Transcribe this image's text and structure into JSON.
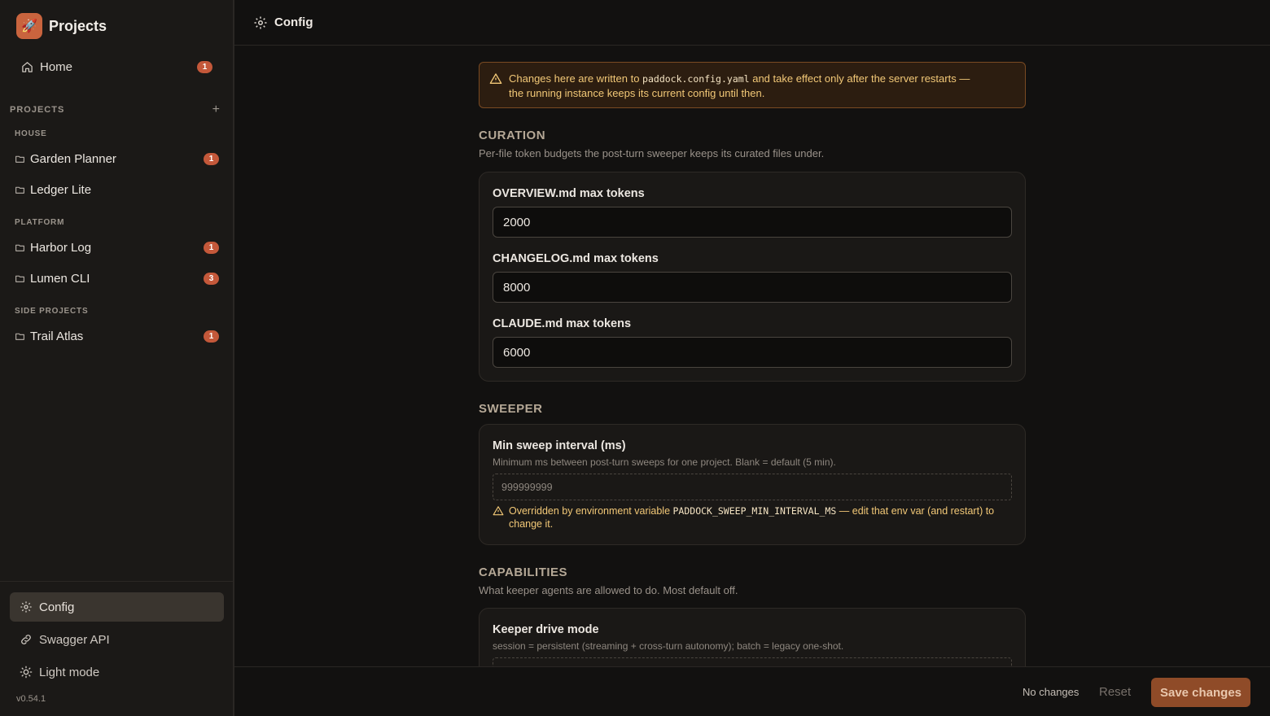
{
  "app": {
    "title": "Projects",
    "logo_glyph": "🚀",
    "version": "v0.54.1"
  },
  "sidebar": {
    "home": {
      "label": "Home",
      "badge": "1"
    },
    "projects_label": "PROJECTS",
    "add_glyph": "+",
    "groups": [
      {
        "label": "HOUSE",
        "items": [
          {
            "label": "Garden Planner",
            "badge": "1"
          },
          {
            "label": "Ledger Lite",
            "badge": ""
          }
        ]
      },
      {
        "label": "PLATFORM",
        "items": [
          {
            "label": "Harbor Log",
            "badge": "1"
          },
          {
            "label": "Lumen CLI",
            "badge": "3"
          }
        ]
      },
      {
        "label": "SIDE PROJECTS",
        "items": [
          {
            "label": "Trail Atlas",
            "badge": "1"
          }
        ]
      }
    ],
    "bottom": {
      "config": "Config",
      "swagger": "Swagger API",
      "theme": "Light mode"
    }
  },
  "topbar": {
    "title": "Config"
  },
  "banner": {
    "pre": "Changes here are written to ",
    "code": "paddock.config.yaml",
    "post": " and take effect only after the server restarts —",
    "line2": "the running instance keeps its current config until then."
  },
  "curation": {
    "title": "CURATION",
    "desc": "Per-file token budgets the post-turn sweeper keeps its curated files under.",
    "fields": [
      {
        "label": "OVERVIEW.md max tokens",
        "value": "2000"
      },
      {
        "label": "CHANGELOG.md max tokens",
        "value": "8000"
      },
      {
        "label": "CLAUDE.md max tokens",
        "value": "6000"
      }
    ]
  },
  "sweeper": {
    "title": "SWEEPER",
    "field_label": "Min sweep interval (ms)",
    "help": "Minimum ms between post-turn sweeps for one project. Blank = default (5 min).",
    "value": "999999999",
    "override_pre": "Overridden by environment variable ",
    "override_code": "PADDOCK_SWEEP_MIN_INTERVAL_MS",
    "override_post": " — edit that env var (and restart) to",
    "override_line2": "change it."
  },
  "capabilities": {
    "title": "CAPABILITIES",
    "desc": "What keeper agents are allowed to do. Most default off.",
    "field_label": "Keeper drive mode",
    "help": "session = persistent (streaming + cross-turn autonomy); batch = legacy one-shot."
  },
  "footer": {
    "status": "No changes",
    "reset": "Reset",
    "save": "Save changes"
  }
}
